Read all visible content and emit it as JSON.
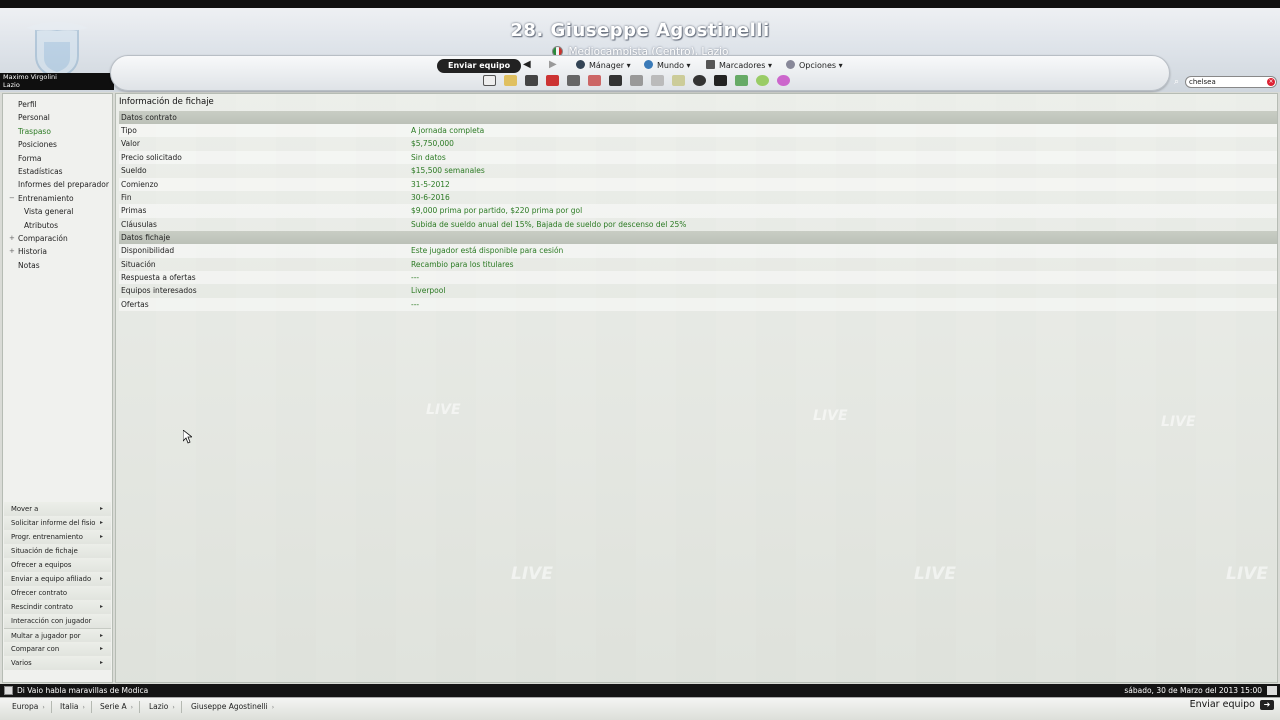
{
  "header": {
    "title": "28. Giuseppe Agostinelli",
    "subtitle": "Mediocampista (Centro), Lazio",
    "manager_name": "Maximo Virgolini",
    "manager_club": "Lazio"
  },
  "toolbar": {
    "send_label": "Enviar equipo",
    "menus": [
      "Mánager",
      "Mundo",
      "Marcadores",
      "Opciones"
    ]
  },
  "search": {
    "value": "chelsea"
  },
  "sidebar": {
    "items": [
      {
        "label": "Perfil"
      },
      {
        "label": "Personal"
      },
      {
        "label": "Traspaso",
        "active": true
      },
      {
        "label": "Posiciones"
      },
      {
        "label": "Forma"
      },
      {
        "label": "Estadísticas"
      },
      {
        "label": "Informes del preparador"
      },
      {
        "label": "Entrenamiento",
        "expand": "−"
      },
      {
        "label": "Vista general",
        "sub": true
      },
      {
        "label": "Atributos",
        "sub": true
      },
      {
        "label": "Comparación",
        "expand": "+"
      },
      {
        "label": "Historia",
        "expand": "+"
      },
      {
        "label": "Notas"
      }
    ],
    "actions": [
      {
        "label": "Mover a",
        "arrow": true
      },
      {
        "label": "Solicitar informe del fisio",
        "arrow": true
      },
      {
        "label": "Progr. entrenamiento",
        "arrow": true
      },
      {
        "label": "Situación de fichaje"
      },
      {
        "label": "Ofrecer a equipos"
      },
      {
        "label": "Enviar a equipo afiliado",
        "arrow": true
      },
      {
        "label": "Ofrecer contrato"
      },
      {
        "label": "Rescindir contrato",
        "arrow": true
      },
      {
        "label": "Interacción con jugador"
      },
      {
        "label": "Multar a jugador por",
        "arrow": true,
        "sep": true
      },
      {
        "label": "Comparar con",
        "arrow": true
      },
      {
        "label": "Varios",
        "arrow": true
      }
    ]
  },
  "main": {
    "title": "Información de fichaje",
    "groups": [
      {
        "title": "Datos contrato",
        "rows": [
          {
            "key": "Tipo",
            "value": "A jornada completa"
          },
          {
            "key": "Valor",
            "value": "$5,750,000"
          },
          {
            "key": "Precio solicitado",
            "value": "Sin datos"
          },
          {
            "key": "Sueldo",
            "value": "$15,500 semanales"
          },
          {
            "key": "Comienzo",
            "value": "31-5-2012"
          },
          {
            "key": "Fin",
            "value": "30-6-2016"
          },
          {
            "key": "Primas",
            "value": "$9,000 prima por partido, $220 prima por gol"
          },
          {
            "key": "Cláusulas",
            "value": "Subida de sueldo anual del 15%, Bajada de sueldo por descenso del 25%"
          }
        ]
      },
      {
        "title": "Datos fichaje",
        "rows": [
          {
            "key": "Disponibilidad",
            "value": "Este jugador está disponible para cesión"
          },
          {
            "key": "Situación",
            "value": "Recambio para los titulares"
          },
          {
            "key": "Respuesta a ofertas",
            "value": "---"
          },
          {
            "key": "Equipos interesados",
            "value": "Liverpool"
          },
          {
            "key": "Ofertas",
            "value": "---"
          }
        ]
      }
    ],
    "background_text": "LIVE"
  },
  "status": {
    "news": "Di Vaio habla maravillas de Modica",
    "datetime": "sábado, 30 de Marzo del 2013 15:00"
  },
  "breadcrumbs": [
    "Europa",
    "Italia",
    "Serie A",
    "Lazio",
    "Giuseppe Agostinelli"
  ],
  "bottom": {
    "send_label": "Enviar equipo"
  },
  "colors": {
    "accent_green": "#2b7a23",
    "dark": "#141414"
  }
}
